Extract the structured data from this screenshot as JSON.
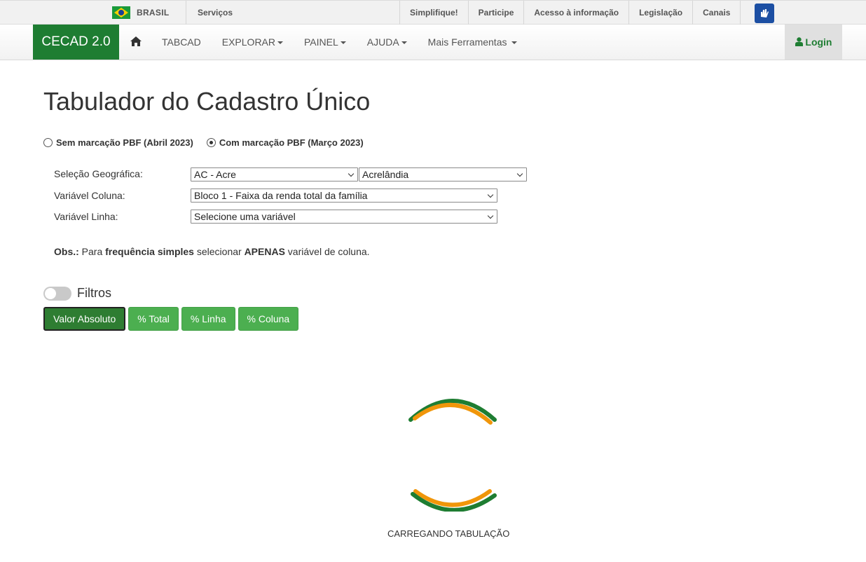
{
  "govbar": {
    "brasil": "BRASIL",
    "servicos": "Serviços",
    "links": [
      "Simplifique!",
      "Participe",
      "Acesso à informação",
      "Legislação",
      "Canais"
    ]
  },
  "navbar": {
    "brand": "CECAD 2.0",
    "items": [
      {
        "label": "TABCAD",
        "dropdown": false
      },
      {
        "label": "EXPLORAR",
        "dropdown": true
      },
      {
        "label": "PAINEL",
        "dropdown": true
      },
      {
        "label": "AJUDA",
        "dropdown": true
      },
      {
        "label": "Mais Ferramentas",
        "dropdown": true
      }
    ],
    "login": "Login"
  },
  "page": {
    "title": "Tabulador do Cadastro Único",
    "radio_options": [
      {
        "label": "Sem marcação PBF (Abril 2023)",
        "checked": false
      },
      {
        "label": "Com marcação PBF (Março 2023)",
        "checked": true
      }
    ],
    "form": {
      "geo_label": "Seleção Geográfica:",
      "geo_state": "AC - Acre",
      "geo_city": "Acrelândia",
      "col_label": "Variável Coluna:",
      "col_value": "Bloco 1 - Faixa da renda total da família",
      "row_label": "Variável Linha:",
      "row_value": "Selecione uma variável"
    },
    "obs": {
      "prefix": "Obs.:",
      "t1": " Para ",
      "bold1": "frequência simples",
      "t2": " selecionar ",
      "bold2": "APENAS",
      "t3": " variável de coluna."
    },
    "filtros": "Filtros",
    "buttons": [
      "Valor Absoluto",
      "% Total",
      "% Linha",
      "% Coluna"
    ],
    "loading": "CARREGANDO TABULAÇÃO"
  },
  "colors": {
    "brand_green": "#1e7d32",
    "button_green": "#4caf50",
    "loader_orange": "#f0960a"
  }
}
